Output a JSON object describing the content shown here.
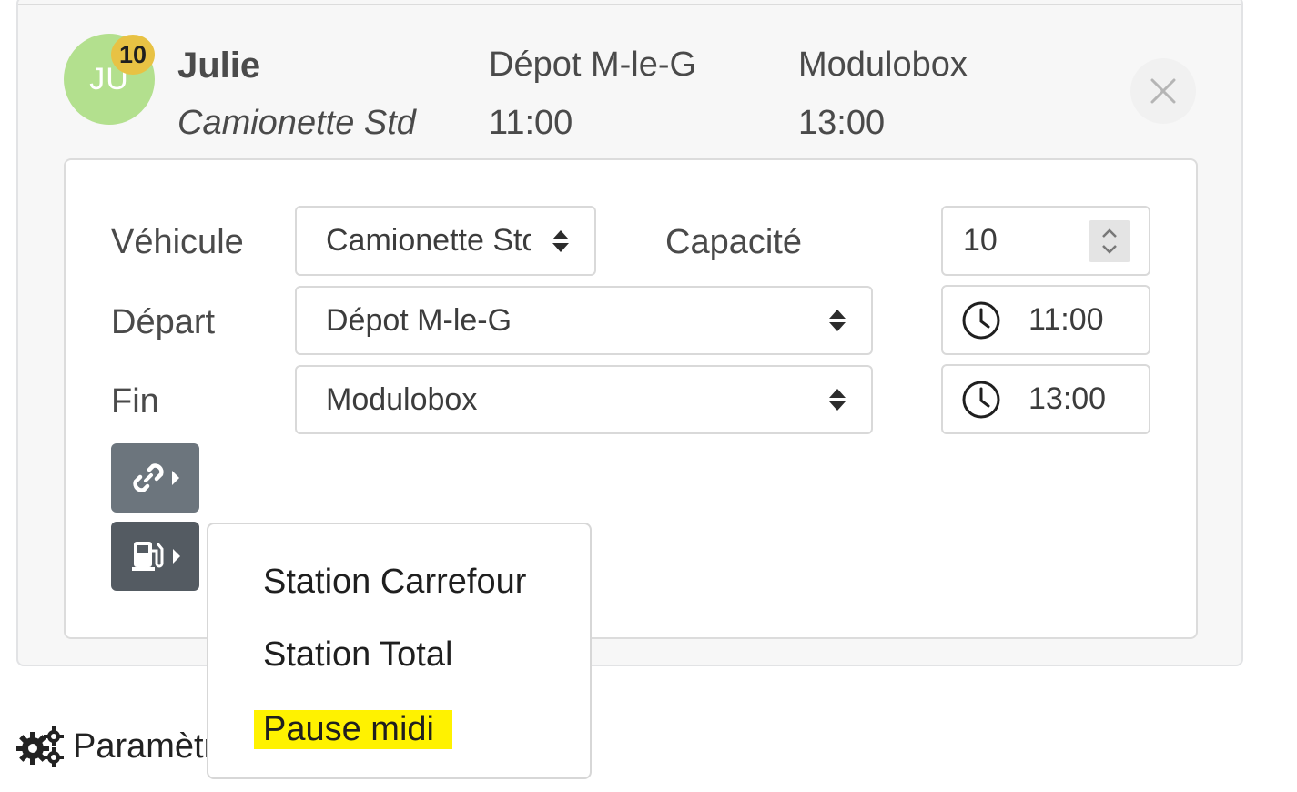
{
  "route": {
    "driver_initials": "JU",
    "badge_count": "10",
    "driver_name": "Julie",
    "vehicle": "Camionette Std",
    "departure_name": "Dépot M-le-G",
    "departure_time": "11:00",
    "end_name": "Modulobox",
    "end_time": "13:00"
  },
  "form": {
    "vehicle_label": "Véhicule",
    "vehicle_value": "Camionette Std",
    "capacity_label": "Capacité",
    "capacity_value": "10",
    "departure_label": "Départ",
    "departure_value": "Dépot M-le-G",
    "departure_time": "11:00",
    "end_label": "Fin",
    "end_value": "Modulobox",
    "end_time": "13:00"
  },
  "icons": {
    "link_button": "link-icon",
    "fuel_button": "gas-pump-icon",
    "close": "close-icon",
    "clock": "clock-icon",
    "settings": "gears-icon"
  },
  "dropdown": {
    "items": [
      "Station Carrefour",
      "Station Total",
      "Pause midi"
    ],
    "highlight_color": "#fff200"
  },
  "footer": {
    "settings_label": "Paramètr"
  },
  "colors": {
    "avatar": "#b3e08e",
    "badge": "#e8c244",
    "button_secondary": "#6c757d",
    "button_active": "#545b62"
  }
}
